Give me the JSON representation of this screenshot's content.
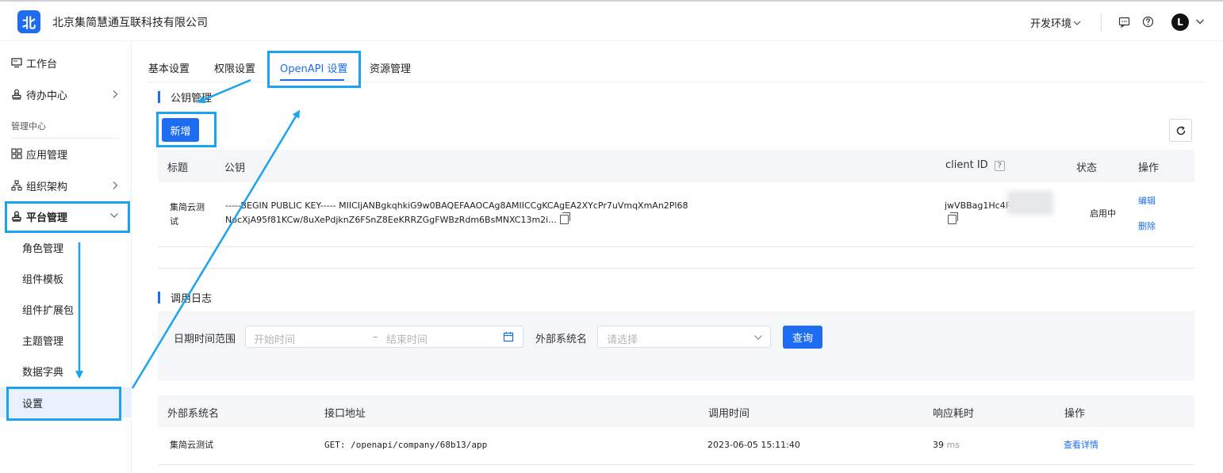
{
  "app": {
    "logo_char": "北",
    "company": "北京集简慧通互联科技有限公司",
    "env_label": "开发环境",
    "avatar_letter": "L"
  },
  "sidebar": {
    "top_items": [
      {
        "label": "工作台",
        "icon": "monitor-icon"
      },
      {
        "label": "待办中心",
        "icon": "stamp-icon"
      }
    ],
    "group_label": "管理中心",
    "mgmt_items": [
      {
        "label": "应用管理",
        "icon": "grid-icon"
      },
      {
        "label": "组织架构",
        "icon": "org-chart-icon"
      },
      {
        "label": "平台管理",
        "icon": "stamp-icon"
      }
    ],
    "platform_sub": [
      "角色管理",
      "组件模板",
      "组件扩展包",
      "主题管理",
      "数据字典",
      "设置"
    ]
  },
  "tabs": [
    "基本设置",
    "权限设置",
    "OpenAPI 设置",
    "资源管理"
  ],
  "key_section": {
    "title": "公钥管理",
    "add_label": "新增",
    "columns": [
      "标题",
      "公钥",
      "client ID",
      "状态",
      "操作"
    ],
    "help_mark": "?",
    "row": {
      "title_line1": "集简云测",
      "title_line2": "试",
      "key_line1": "-----BEGIN PUBLIC KEY----- MIICIjANBgkqhkiG9w0BAQEFAAOCAg8AMIICCgKCAgEA2XYcPr7uVmqXmAn2Pl68",
      "key_line2": "NocXjA95f81KCw/8uXePdjknZ6FSnZ8EeKRRZGgFWBzRdm6BsMNXC13m2i...",
      "client_id": "jwVBBag1Hc4F8jl",
      "status": "启用中",
      "edit": "编辑",
      "delete": "删除"
    }
  },
  "log_section": {
    "title": "调用日志",
    "date_label": "日期时间范围",
    "start_ph": "开始时间",
    "range_sep": "–",
    "end_ph": "结束时间",
    "system_label": "外部系统名",
    "select_ph": "请选择",
    "query_label": "查询",
    "columns": [
      "外部系统名",
      "接口地址",
      "调用时间",
      "响应耗时",
      "操作"
    ],
    "row": {
      "system": "集简云测试",
      "api": "GET: /openapi/company/68b13/app",
      "time": "2023-06-05 15:11:40",
      "latency": "39",
      "latency_unit": "ms",
      "action": "查看详情"
    }
  },
  "colors": {
    "primary": "#1e6cf0",
    "annotation": "#1aa3f0"
  }
}
